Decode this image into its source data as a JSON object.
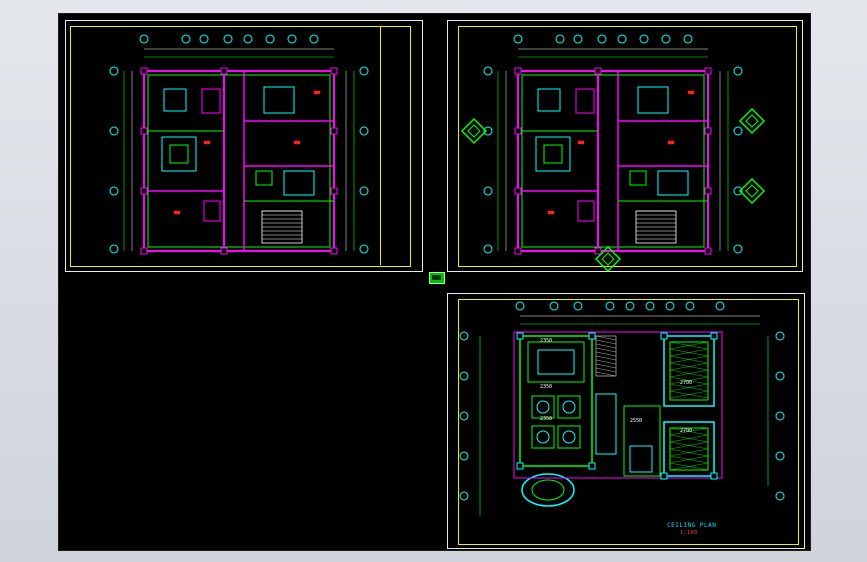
{
  "viewer": {
    "background_color": "#000000",
    "sheet_border_color": "#e8e8e8",
    "title_block_color": "#f0f000"
  },
  "sheets": [
    {
      "id": "floor-plan-1",
      "kind": "floor-plan"
    },
    {
      "id": "floor-plan-2",
      "kind": "floor-plan"
    },
    {
      "id": "ceiling-plan",
      "kind": "ceiling-plan",
      "caption": "CEILING PLAN",
      "scale_note": "1:100"
    }
  ],
  "ceiling_labels": [
    "2350",
    "2350",
    "2350",
    "2700",
    "2700",
    "2550"
  ],
  "palette": {
    "wall": "#ff00ff",
    "grid": "#00ff00",
    "fixture": "#00ffff",
    "dimension": "#ffffff",
    "room_label": "#ff2020",
    "hatch": "#aaaaaa"
  }
}
